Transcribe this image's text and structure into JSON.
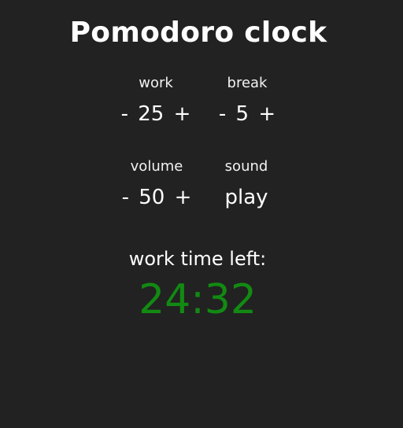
{
  "app": {
    "title": "Pomodoro clock"
  },
  "controls": {
    "work": {
      "label": "work",
      "decrement": "-",
      "value": "25",
      "increment": "+"
    },
    "break": {
      "label": "break",
      "decrement": "-",
      "value": "5",
      "increment": "+"
    },
    "volume": {
      "label": "volume",
      "decrement": "-",
      "value": "50",
      "increment": "+"
    },
    "sound": {
      "label": "sound",
      "action": "play"
    }
  },
  "status": {
    "label": "work time left:",
    "time": "24:32"
  },
  "colors": {
    "background": "#222222",
    "text": "#ffffff",
    "timer": "#128a12"
  }
}
